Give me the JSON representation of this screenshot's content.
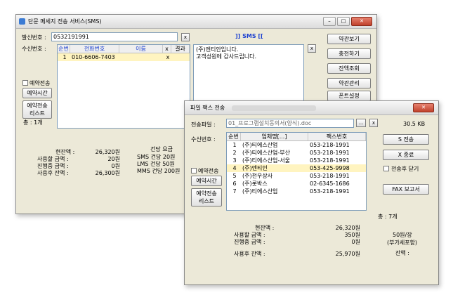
{
  "sms": {
    "title": "단문 메세지 전송 서비스(SMS)",
    "sender_label": "발신번호 :",
    "sender_value": "0532191991",
    "clear": "x",
    "banner": "]] SMS [[",
    "recipient_label": "수신번호 :",
    "grid_headers": [
      "순번",
      "전화번호",
      "이름",
      "x",
      "결과"
    ],
    "rows": [
      {
        "no": "1",
        "phone": "010-6606-7403",
        "name": "",
        "x": "x",
        "result": ""
      }
    ],
    "message": [
      "(주)엔티안입니다.",
      "고객성원에 감사드립니다."
    ],
    "reserve_check_label": "예약전송",
    "reserve_time_button": "예약시간",
    "reserve_list_button_line1": "예약전송",
    "reserve_list_button_line2": "리스트",
    "total": "총 : 1개",
    "right_buttons": [
      "약관보기",
      "충전하기",
      "잔액조회",
      "약관관리",
      "폰트설정"
    ],
    "balance": {
      "labels": [
        "현잔액 :",
        "사용할 금액 :",
        "진행중 금액 :",
        "사용후 잔액 :"
      ],
      "values": [
        "26,320원",
        "20원",
        "0원",
        "26,300원"
      ]
    },
    "rate_title": "건당 요금",
    "rates": [
      "SMS 건당 20원",
      "LMS 건당 50원",
      "MMS 건당 200원"
    ]
  },
  "fax": {
    "title": "파일 팩스 전송",
    "file_label": "전송파일 :",
    "file_value": "01_프로그램설치동의서(양식).doc",
    "browse": "...",
    "clear": "x",
    "file_size": "30.5 KB",
    "recipient_label": "수신번호 :",
    "grid_headers": [
      "순번",
      "업체명[...]",
      "팩스번호"
    ],
    "rows": [
      {
        "no": "1",
        "company": "(주)티에스산업",
        "fax": "053-218-1991"
      },
      {
        "no": "2",
        "company": "(주)티에스산업-부산",
        "fax": "053-218-1991"
      },
      {
        "no": "3",
        "company": "(주)티에스산업-서울",
        "fax": "053-218-1991"
      },
      {
        "no": "4",
        "company": "(주)엔티인",
        "fax": "053-425-9998"
      },
      {
        "no": "5",
        "company": "(주)천우상사",
        "fax": "053-218-1991"
      },
      {
        "no": "6",
        "company": "(주)롯박스",
        "fax": "02-6345-1686"
      },
      {
        "no": "7",
        "company": "(주)티에스산업",
        "fax": "053-218-1991"
      }
    ],
    "send_button": "S 전송",
    "close_button": "X 종료",
    "close_after_label": "전송후 닫기",
    "report_button": "FAX 보고서",
    "reserve_check_label": "예약전송",
    "reserve_time_button": "예약시간",
    "reserve_list_button_line1": "예약전송",
    "reserve_list_button_line2": "리스트",
    "total": "총 : 7개",
    "balance": {
      "labels": [
        "현잔액 :",
        "사용할 금액 :",
        "진행중 금액 :",
        "사용후 잔액 :"
      ],
      "values": [
        "26,320원",
        "350원",
        "0원",
        "25,970원"
      ]
    },
    "rate": "50원/장",
    "vat": "(부가세포함)",
    "remaining_label": "잔액 :"
  },
  "colors": {
    "highlight": "#fff4c0",
    "link_blue": "#1a3fd0",
    "window_bg": "#ece9d8"
  }
}
